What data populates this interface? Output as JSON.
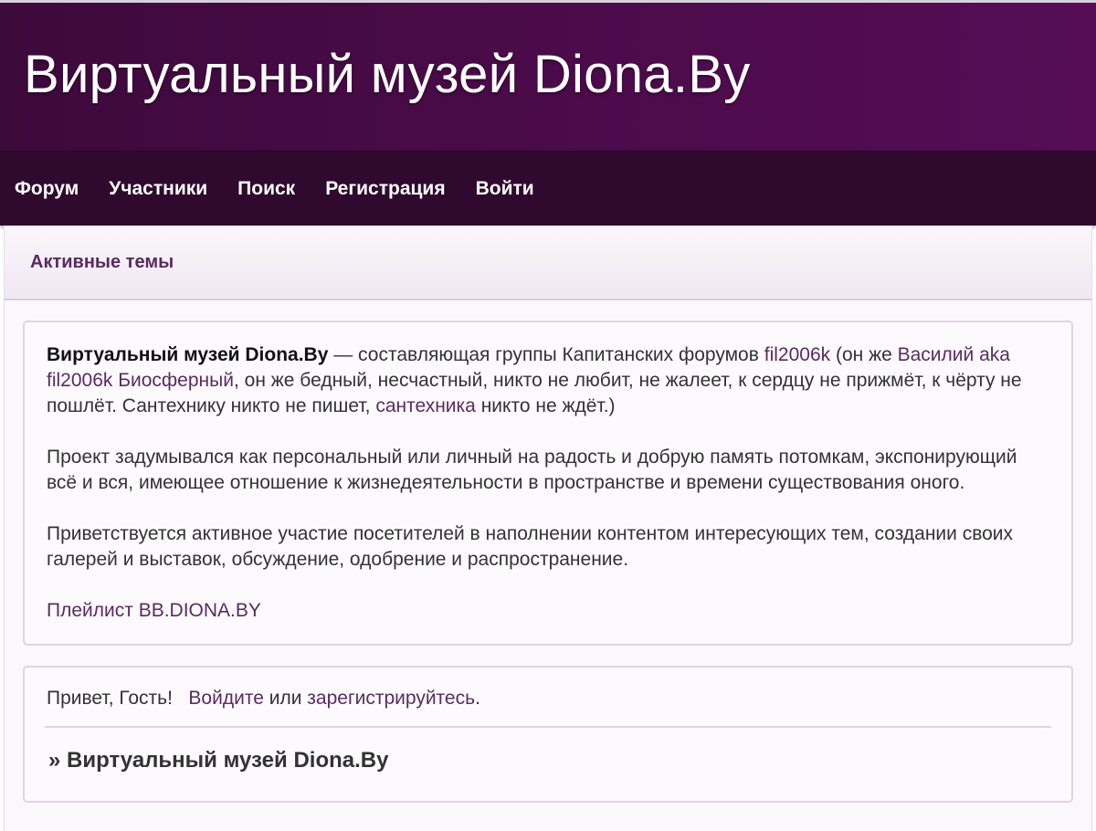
{
  "header": {
    "site_title": "Виртуальный музей Diona.By"
  },
  "nav": {
    "items": [
      {
        "label": "Форум"
      },
      {
        "label": "Участники"
      },
      {
        "label": "Поиск"
      },
      {
        "label": "Регистрация"
      },
      {
        "label": "Войти"
      }
    ]
  },
  "active_topics": {
    "label": "Активные темы"
  },
  "info": {
    "p1": {
      "strong": "Виртуальный музей Diona.By",
      "t1": " — составляющая группы Капитанских форумов ",
      "link1": "fil2006k",
      "t2": " (он же ",
      "link2": "Василий aka fil2006k Биосферный",
      "t3": ", он же бедный, несчастный, никто не любит, не жалеет, к сердцу не прижмёт, к чёрту не пошлёт. Сантехнику никто не пишет, ",
      "link3": "сантехника",
      "t4": " никто не ждёт.)"
    },
    "p2": "Проект задумывался как персональный или личный на радость и добрую память потомкам, экспонирующий всё и вся, имеющее отношение к жизнедеятельности в пространстве и времени существования оного.",
    "p3": "Приветствуется активное участие посетителей в наполнении контентом интересующих тем, создании своих галерей и выставок, обсуждение, одобрение и распространение.",
    "playlist_link": "Плейлист BB.DIONA.BY"
  },
  "guest": {
    "greeting": "Привет, Гость!",
    "login_link": "Войдите",
    "or_text": "или",
    "register_link": "зарегистрируйтесь",
    "period": "."
  },
  "breadcrumb": {
    "text": "» Виртуальный музей Diona.By"
  },
  "colors": {
    "header_bg": "#4b0b4a",
    "nav_bg": "#2f0a2e",
    "link": "#5b2a63",
    "border": "#e2d2e6"
  }
}
